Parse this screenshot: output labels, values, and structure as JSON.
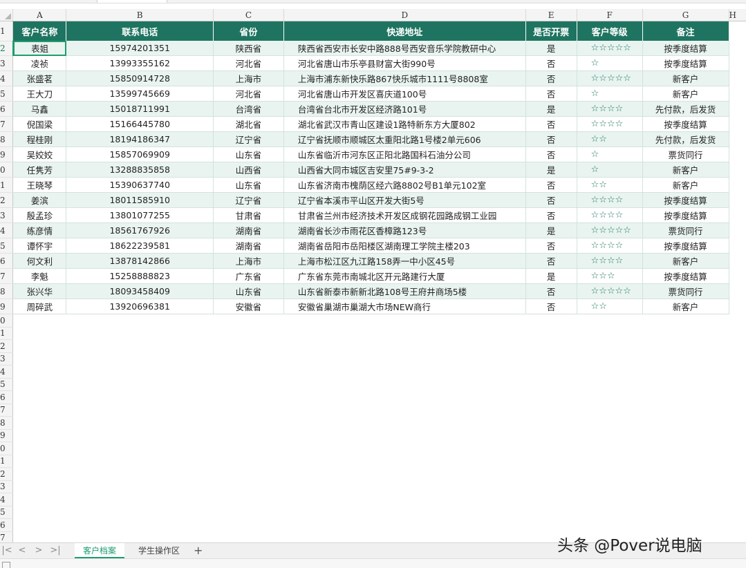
{
  "columns": [
    "A",
    "B",
    "C",
    "D",
    "E",
    "F",
    "G",
    "H"
  ],
  "row_numbers": [
    "1",
    "2",
    "3",
    "4",
    "5",
    "6",
    "7",
    "8",
    "9",
    "0",
    "1",
    "2",
    "3",
    "4",
    "5",
    "6",
    "7",
    "8",
    "9",
    "0",
    "1",
    "2",
    "3",
    "4",
    "5",
    "6",
    "7",
    "8",
    "9",
    "0",
    "1",
    "2",
    "3",
    "4",
    "5",
    "6",
    "7"
  ],
  "headers": [
    "客户名称",
    "联系电话",
    "省份",
    "快递地址",
    "是否开票",
    "客户等级",
    "备注"
  ],
  "rows": [
    {
      "name": "表姐",
      "phone": "15974201351",
      "province": "陕西省",
      "address": "陕西省西安市长安中路888号西安音乐学院教研中心",
      "invoice": "是",
      "level": "☆☆☆☆☆",
      "note": "按季度结算"
    },
    {
      "name": "凌祯",
      "phone": "13993355162",
      "province": "河北省",
      "address": "河北省唐山市乐亭县财富大街990号",
      "invoice": "否",
      "level": "☆",
      "note": "按季度结算"
    },
    {
      "name": "张盛茗",
      "phone": "15850914728",
      "province": "上海市",
      "address": "上海市浦东新快乐路867快乐城市1111号8808室",
      "invoice": "否",
      "level": "☆☆☆☆☆",
      "note": "新客户"
    },
    {
      "name": "王大刀",
      "phone": "13599745669",
      "province": "河北省",
      "address": "河北省唐山市开发区喜庆道100号",
      "invoice": "否",
      "level": "☆",
      "note": "新客户"
    },
    {
      "name": "马鑫",
      "phone": "15018711991",
      "province": "台湾省",
      "address": "台湾省台北市开发区经济路101号",
      "invoice": "是",
      "level": "☆☆☆☆",
      "note": "先付款，后发货"
    },
    {
      "name": "倪国梁",
      "phone": "15166445780",
      "province": "湖北省",
      "address": "湖北省武汉市青山区建设1路特新东方大厦802",
      "invoice": "否",
      "level": "☆☆☆☆",
      "note": "按季度结算"
    },
    {
      "name": "程桂刚",
      "phone": "18194186347",
      "province": "辽宁省",
      "address": "辽宁省抚顺市顺城区太重阳北路1号楼2单元606",
      "invoice": "否",
      "level": "☆☆",
      "note": "先付款，后发货"
    },
    {
      "name": "吴姣姣",
      "phone": "15857069909",
      "province": "山东省",
      "address": "山东省临沂市河东区正阳北路国科石油分公司",
      "invoice": "否",
      "level": "☆",
      "note": "票货同行"
    },
    {
      "name": "任隽芳",
      "phone": "13288835858",
      "province": "山西省",
      "address": "山西省大同市城区吉安里75#9-3-2",
      "invoice": "是",
      "level": "☆",
      "note": "新客户"
    },
    {
      "name": "王晓琴",
      "phone": "15390637740",
      "province": "山东省",
      "address": "山东省济南市槐荫区经六路8802号B1单元102室",
      "invoice": "否",
      "level": "☆☆",
      "note": "新客户"
    },
    {
      "name": "姜滨",
      "phone": "18011585910",
      "province": "辽宁省",
      "address": "辽宁省本溪市平山区开发大街5号",
      "invoice": "否",
      "level": "☆☆☆☆",
      "note": "按季度结算"
    },
    {
      "name": "殷孟珍",
      "phone": "13801077255",
      "province": "甘肃省",
      "address": "甘肃省兰州市经济技术开发区成钢花园路成钢工业园",
      "invoice": "否",
      "level": "☆☆☆☆",
      "note": "按季度结算"
    },
    {
      "name": "练彦情",
      "phone": "18561767926",
      "province": "湖南省",
      "address": "湖南省长沙市雨花区香樟路123号",
      "invoice": "是",
      "level": "☆☆☆☆☆",
      "note": "票货同行"
    },
    {
      "name": "谭怀宇",
      "phone": "18622239581",
      "province": "湖南省",
      "address": "湖南省岳阳市岳阳楼区湖南理工学院主楼203",
      "invoice": "否",
      "level": "☆☆☆☆",
      "note": "按季度结算"
    },
    {
      "name": "何文利",
      "phone": "13878142866",
      "province": "上海市",
      "address": "上海市松江区九江路158弄一中小区45号",
      "invoice": "否",
      "level": "☆☆☆☆",
      "note": "新客户"
    },
    {
      "name": "李魁",
      "phone": "15258888823",
      "province": "广东省",
      "address": "广东省东莞市南城北区开元路建行大厦",
      "invoice": "是",
      "level": "☆☆☆",
      "note": "按季度结算"
    },
    {
      "name": "张兴华",
      "phone": "18093458409",
      "province": "山东省",
      "address": "山东省新泰市新新北路108号王府井商场5楼",
      "invoice": "否",
      "level": "☆☆☆☆☆",
      "note": "票货同行"
    },
    {
      "name": "周碎武",
      "phone": "13920696381",
      "province": "安徽省",
      "address": "安徽省巢湖市巢湖大市场NEW商行",
      "invoice": "否",
      "level": "☆☆",
      "note": "新客户"
    }
  ],
  "sheet_tabs": [
    "客户档案",
    "学生操作区"
  ],
  "add_sheet": "+",
  "nav_icons": [
    "|<",
    "<",
    ">",
    ">|"
  ],
  "watermark": "头条 @Pover说电脑",
  "colors": {
    "header_bg": "#1e7460",
    "band": "#e9f4f0",
    "accent": "#1e9d6c"
  }
}
